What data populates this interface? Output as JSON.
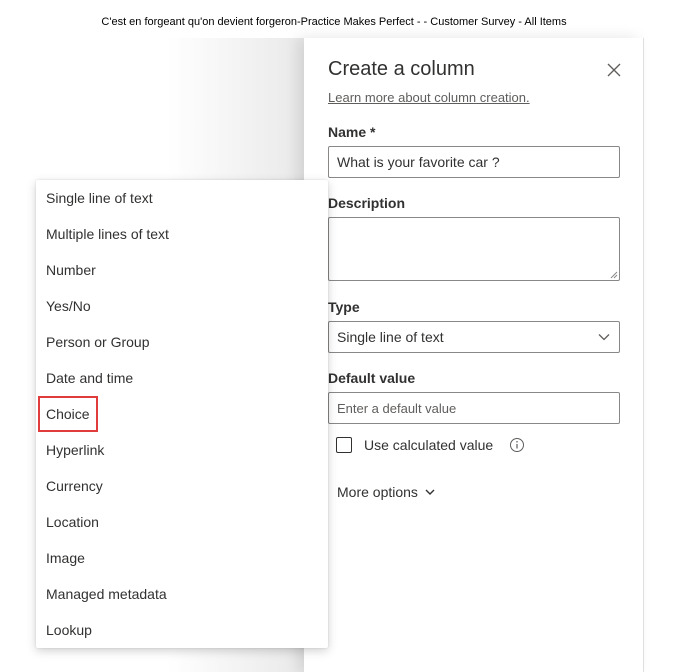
{
  "window": {
    "title": "C'est en forgeant qu'on devient forgeron-Practice Makes Perfect - - Customer Survey - All Items"
  },
  "panel": {
    "title": "Create a column",
    "learn_more_link": "Learn more about column creation.",
    "name_label": "Name *",
    "name_value": "What is your favorite car ?",
    "description_label": "Description",
    "description_value": "",
    "type_label": "Type",
    "type_value": "Single line of text",
    "default_value_label": "Default value",
    "default_value_placeholder": "Enter a default value",
    "use_calculated_label": "Use calculated value",
    "use_calculated_checked": false,
    "more_options_label": "More options"
  },
  "type_dropdown": {
    "items": [
      "Single line of text",
      "Multiple lines of text",
      "Number",
      "Yes/No",
      "Person or Group",
      "Date and time",
      "Choice",
      "Hyperlink",
      "Currency",
      "Location",
      "Image",
      "Managed metadata",
      "Lookup"
    ],
    "highlighted_item": "Choice",
    "highlight_color": "#e03c3c"
  },
  "icons": {
    "close": "close-icon",
    "chevron_down": "chevron-down-icon",
    "info": "info-icon"
  }
}
